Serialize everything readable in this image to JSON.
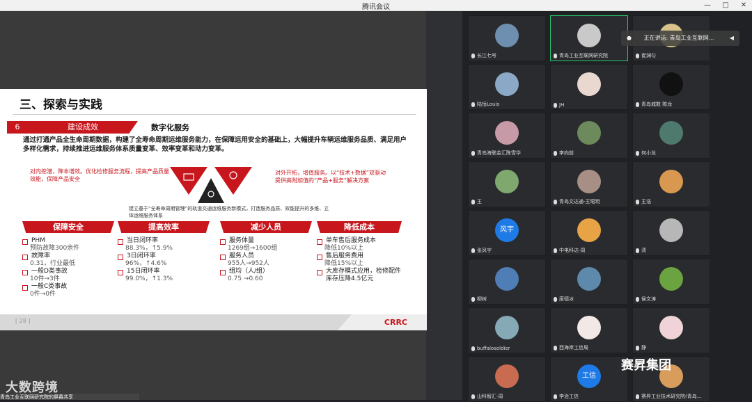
{
  "window": {
    "title": "腾讯会议",
    "controls": [
      "—",
      "□",
      "✕"
    ]
  },
  "slide": {
    "section_title": "三、探索与实践",
    "number": "6",
    "banner": "建设成效",
    "subhead": "数字化服务",
    "intro": "通过打通产品全生命周期数据，构建了全寿命周期运维服务能力，在保障运用安全的基础上，大幅提升车辆运维服务品质、满足用户多样化需求，持续推进运维服务体系质量变革、效率变革和动力变革。",
    "left_red": "对内挖潜，降本增效。优化检修服务流程，提高产品质量效能，保障产品安全",
    "right_red": "对外开拓，增值服务。以“技术+数据”双驱动提供高附加值的“产品+服务”解决方案",
    "middle": "建立基于“全寿命周期管理”的轨道交通运维服务新模式，打造服务品质、效能提升的多维、立体运维服务体系",
    "columns": [
      {
        "title": "保障安全",
        "items": [
          {
            "label": "PHM",
            "sub": "预防故障300余件"
          },
          {
            "label": "故障率",
            "sub": "0.31，行业最低"
          },
          {
            "label": "一般D类事故",
            "sub": "10件→3件"
          },
          {
            "label": "一般C类事故",
            "sub": "0件→0件"
          }
        ]
      },
      {
        "title": "提高效率",
        "items": [
          {
            "label": "当日闭环率",
            "sub": "88.3%，↑5.9%"
          },
          {
            "label": "3日闭环率",
            "sub": "96%，↑4.6%"
          },
          {
            "label": "15日闭环率",
            "sub": "99.0%，↑1.3%"
          }
        ]
      },
      {
        "title": "减少人员",
        "items": [
          {
            "label": "服务体量",
            "sub": "1269组→1600组"
          },
          {
            "label": "服务人员",
            "sub": "955人→952人"
          },
          {
            "label": "组均（人/组）",
            "sub": "0.75 →0.60"
          }
        ]
      },
      {
        "title": "降低成本",
        "items": [
          {
            "label": "单车售后服务成本",
            "sub": "降低10%以上"
          },
          {
            "label": "售后服务费用",
            "sub": "降低15%以上"
          },
          {
            "label": "大库存模式应用，检修配件库存压降4.5亿元",
            "sub": ""
          }
        ]
      }
    ],
    "page_num": "[ 28 ]",
    "logo": "CRRC"
  },
  "speaking": {
    "label": "正在讲话: 青岛工业互联网..."
  },
  "participants": [
    {
      "name": "长江七号",
      "color": "#6f8fb0"
    },
    {
      "name": "青岛工业互联网研究院",
      "color": "#c9c9c9",
      "active": true
    },
    {
      "name": "崔渊匀",
      "color": "#d8c38b"
    },
    {
      "name": "陆恒Louis",
      "color": "#8ba9c7"
    },
    {
      "name": "JH",
      "color": "#e8d8d0"
    },
    {
      "name": "青岛城数 陈龙",
      "color": "#111111"
    },
    {
      "name": "青岛海联金汇陈雪华",
      "color": "#c79aa8"
    },
    {
      "name": "李向前",
      "color": "#6d8a5c"
    },
    {
      "name": "何小龙",
      "color": "#4d7a6c"
    },
    {
      "name": "王",
      "color": "#7fa86f"
    },
    {
      "name": "青岛文达通-王珺玥",
      "color": "#a88f86"
    },
    {
      "name": "王浩",
      "color": "#d9984f"
    },
    {
      "name": "张风宇",
      "avatar_text": "风宇",
      "color": "#1e7ae6"
    },
    {
      "name": "中电科达-周",
      "color": "#e8a347"
    },
    {
      "name": "清",
      "color": "#b7b7b7"
    },
    {
      "name": "柳树",
      "color": "#4f7db5"
    },
    {
      "name": "唐德冰",
      "color": "#5d89ab"
    },
    {
      "name": "侯文涛",
      "color": "#6aa33f"
    },
    {
      "name": "buffalosoldier",
      "color": "#86a9b6"
    },
    {
      "name": "西海岸工信局",
      "color": "#f2e9e6"
    },
    {
      "name": "静",
      "color": "#efd3d8"
    },
    {
      "name": "山科智汇-周",
      "color": "#c86b50"
    },
    {
      "name": "李治工信",
      "avatar_text": "工信",
      "color": "#1e7ae6"
    },
    {
      "name": "赛昇工业技术研究院(青岛...",
      "color": "#d89c5c"
    }
  ],
  "watermark_left": "大数跨境",
  "watermark_right": "赛昇集团",
  "share_text": "青岛工业互联网研究院的屏幕共享"
}
